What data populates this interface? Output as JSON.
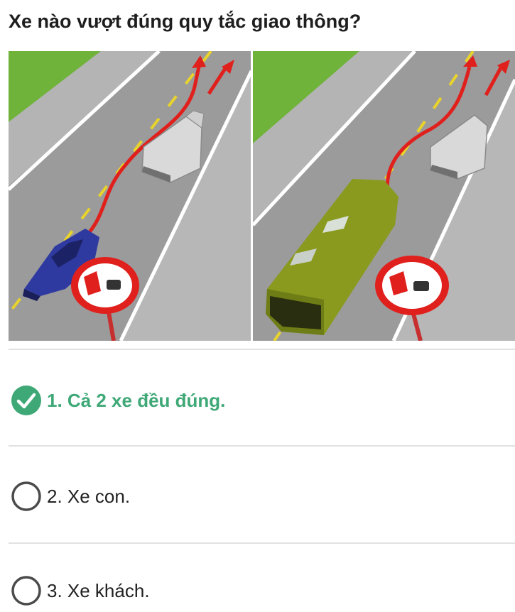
{
  "question": "Xe nào vượt đúng quy tắc giao thông?",
  "colors": {
    "correct": "#3fa877",
    "text": "#222222",
    "radio_border": "#4a4a4a",
    "divider": "#e2e2e2"
  },
  "options": [
    {
      "label": "1. Cả 2 xe đều đúng.",
      "state": "correct",
      "icon": "check-circle-icon"
    },
    {
      "label": "2. Xe con.",
      "state": "unselected",
      "icon": "radio-empty-icon"
    },
    {
      "label": "3. Xe khách.",
      "state": "unselected",
      "icon": "radio-empty-icon"
    }
  ]
}
